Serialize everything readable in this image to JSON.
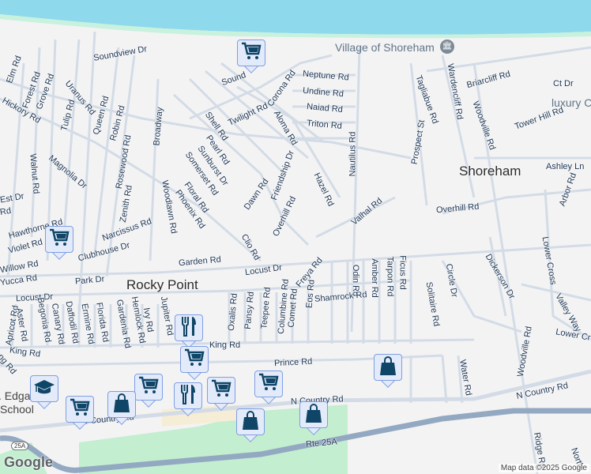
{
  "places": {
    "rocky_point": "Rocky Point",
    "shoreham": "Shoreham"
  },
  "pois": {
    "village": "Village of Shoreham",
    "luxury": "luxury C",
    "school_a": ". Edgar",
    "school_b": "School"
  },
  "streets": [
    "Soundview Dr",
    "Sound",
    "Corona Rd",
    "Elm Rd",
    "Forest Rd",
    "Grove Rd",
    "Hickory Rd",
    "Uranus Rd",
    "Tulip Rd",
    "Queen Rd",
    "Robin Rd",
    "Broadway",
    "Shell Rd",
    "Twilight Rd",
    "Aloma Rd",
    "Pearl Rd",
    "Sunburst Dr",
    "Somerset Rd",
    "Magnolia Dr",
    "Walnut Rd",
    "Rosewood Rd",
    "Friendship Dr",
    "Dawn Rd",
    "Hazel Rd",
    "Zenith Rd",
    "Floral Rd",
    "Woodlawn Rd",
    "Phoenix Rd",
    "Overhill Rd",
    "Clio Rd",
    "Valhal Rd",
    "Hawthorne Rd",
    "Narcissus Rd",
    "Violet Rd",
    "Clubhouse Dr",
    "Willow Rd",
    "Garden Rd",
    "Locust Dr",
    "Freya Rd",
    "Yucca Rd",
    "Park Dr",
    "Locust Dr",
    "Neptune Rd",
    "Undine Rd",
    "Naiad Rd",
    "Triton Rd",
    "Nautilus Rd",
    "Tagliabue Rd",
    "Wardencliff Rd",
    "Woodville Rd",
    "Briarcliff Rd",
    "Tower Hill Rd",
    "Prospect St",
    "Ashley Ln",
    "Arbor Rd",
    "Overhill Rd",
    "Odin Rd",
    "Amber Rd",
    "Tarpon Rd",
    "Ficus Rd",
    "Solitaire Rd",
    "Circle Dr",
    "Dickerson Dr",
    "Lower Cross",
    "Valley Way",
    "Lower Cr",
    "Shamrock Rd",
    "Eos Rd",
    "Comet Rd",
    "Columbine Rd",
    "Teepee Rd",
    "Pansy Rd",
    "Oxalis Rd",
    "Apricot Rd",
    "Aster Rd",
    "Begonia Rd",
    "Canary Rd",
    "Daffodil Rd",
    "Ermine Rd",
    "Florida Rd",
    "Gardenia Rd",
    "Hemlock Rd",
    "Ivy Rd",
    "Jupiter Rd",
    "King Rd",
    "King Rd",
    "ng Rd",
    "Prince Rd",
    "Water Rd",
    "Woodville Rd",
    "N Country Rd",
    "N Country Rd",
    "N Country Rd",
    "Rte 25A",
    "Ridge Rd",
    "North",
    "Est Dr",
    "Rd",
    "Ct Dr"
  ],
  "markers": [
    "shopping-cart",
    "shopping-cart",
    "restaurant",
    "shopping-cart",
    "shopping-cart",
    "shopping-bag",
    "shopping-cart",
    "school",
    "restaurant",
    "shopping-cart",
    "shopping-cart",
    "shopping-bag",
    "shopping-bag",
    "shopping-bag"
  ],
  "route_shield": "25A",
  "footer": {
    "logo": "Google",
    "attribution": "Map data ©2025 Google"
  },
  "colors": {
    "water": "#8fd9ec",
    "park": "#c3eed0",
    "road": "#d3dce6",
    "highway": "#93a9c2",
    "marker_icon": "#0f4566"
  }
}
